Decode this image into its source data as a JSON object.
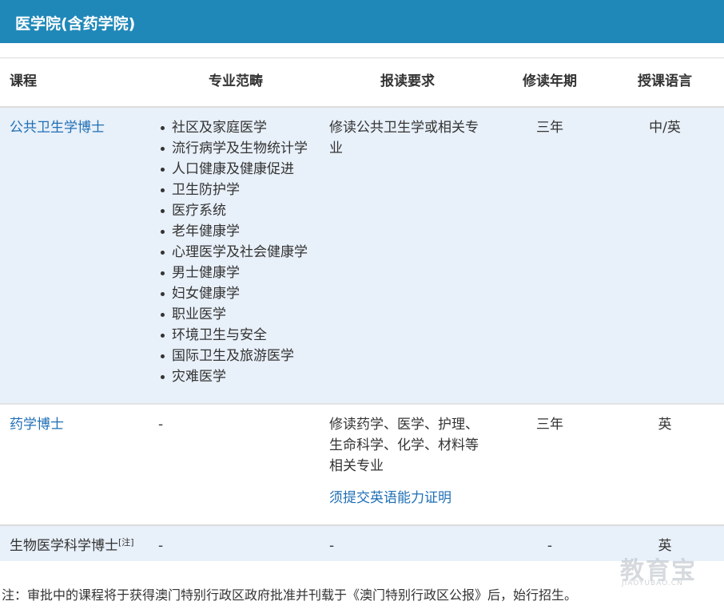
{
  "header": {
    "title": "医学院(含药学院)"
  },
  "table": {
    "columns": [
      "课程",
      "专业范畴",
      "报读要求",
      "修读年期",
      "授课语言"
    ],
    "rows": [
      {
        "course": "公共卫生学博士",
        "majors": [
          "社区及家庭医学",
          "流行病学及生物统计学",
          "人口健康及健康促进",
          "卫生防护学",
          "医疗系统",
          "老年健康学",
          "心理医学及社会健康学",
          "男士健康学",
          "妇女健康学",
          "职业医学",
          "环境卫生与安全",
          "国际卫生及旅游医学",
          "灾难医学"
        ],
        "requirement_lines": [
          "修读公共卫生学或相关专",
          "业"
        ],
        "years": "三年",
        "language": "中/英"
      },
      {
        "course": "药学博士",
        "major": "-",
        "requirement_lines": [
          "修读药学、医学、护理、",
          "生命科学、化学、材料等",
          "相关专业"
        ],
        "requirement_link": "须提交英语能力证明",
        "years": "三年",
        "language": "英"
      },
      {
        "course": "生物医学科学博士",
        "course_note": "[注]",
        "major": "-",
        "requirement": "-",
        "years": "-",
        "language": "英"
      }
    ]
  },
  "footnote": "注：审批中的课程将于获得澳门特别行政区政府批准并刊载于《澳门特别行政区公报》后，始行招生。",
  "watermark": {
    "main": "教育宝",
    "sub": "JIAOYUBAO.CN"
  },
  "colors": {
    "header_bg": "#2088b8",
    "row_tint": "#e8f0f9",
    "link": "#1f6fb6"
  }
}
